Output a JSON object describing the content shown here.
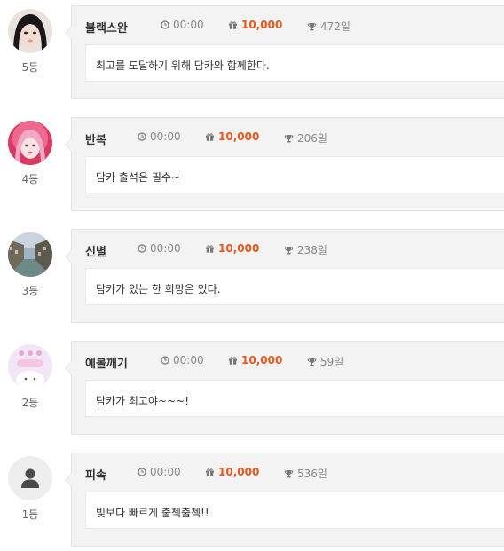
{
  "entries": [
    {
      "name": "블랙스완",
      "rank": "5등",
      "time": "00:00",
      "points": "10,000",
      "streak": "472일",
      "comment": "최고를 도달하기 위해 담카와 함께한다.",
      "avatar_icon": "avatar-photo-girl"
    },
    {
      "name": "반복",
      "rank": "4등",
      "time": "00:00",
      "points": "10,000",
      "streak": "206일",
      "comment": "담카 출석은 필수~",
      "avatar_icon": "avatar-photo-pink-hair"
    },
    {
      "name": "신별",
      "rank": "3등",
      "time": "00:00",
      "points": "10,000",
      "streak": "238일",
      "comment": "담카가 있는 한 희망은 있다.",
      "avatar_icon": "avatar-photo-canal"
    },
    {
      "name": "에볼깨기",
      "rank": "2등",
      "time": "00:00",
      "points": "10,000",
      "streak": "59일",
      "comment": "담카가 최고야~~~!",
      "avatar_icon": "avatar-illustration-pastel"
    },
    {
      "name": "피속",
      "rank": "1등",
      "time": "00:00",
      "points": "10,000",
      "streak": "536일",
      "comment": "빛보다 빠르게 출첵출첵!!",
      "avatar_icon": "avatar-default-user"
    }
  ],
  "colors": {
    "points": "#e8571d",
    "card_bg": "#f3f3f3",
    "meta_text": "#888888"
  },
  "icons": {
    "time": "clock-icon",
    "points": "gift-icon",
    "streak": "trophy-icon"
  }
}
